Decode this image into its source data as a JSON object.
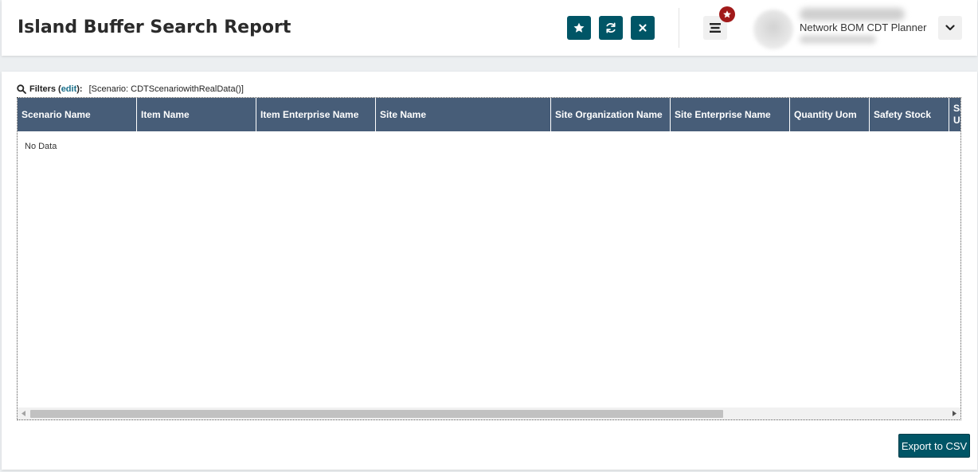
{
  "header": {
    "title": "Island Buffer Search Report",
    "actions": [
      {
        "name": "favorite",
        "icon": "star-icon"
      },
      {
        "name": "refresh",
        "icon": "refresh-icon"
      },
      {
        "name": "close",
        "icon": "close-icon"
      }
    ],
    "menu_icon": "hamburger-menu-icon",
    "notification_icon": "star-badge-icon",
    "user": {
      "role": "Network BOM CDT Planner"
    },
    "colors": {
      "button_bg": "#005566",
      "badge_bg": "#a11a1a"
    }
  },
  "filters": {
    "label": "Filters",
    "open_paren": "(",
    "edit_label": "edit",
    "close_paren": "):",
    "value": "[Scenario: CDTScenariowithRealData()]"
  },
  "grid": {
    "columns": [
      "Scenario Name",
      "Item Name",
      "Item Enterprise Name",
      "Site Name",
      "Site Organization Name",
      "Site Enterprise Name",
      "Quantity Uom",
      "Safety Stock"
    ],
    "clipped_column": {
      "line1": "Sa",
      "line2": "U"
    },
    "empty_message": "No Data",
    "header_color": "#475d78"
  },
  "footer": {
    "export_label": "Export to CSV"
  }
}
